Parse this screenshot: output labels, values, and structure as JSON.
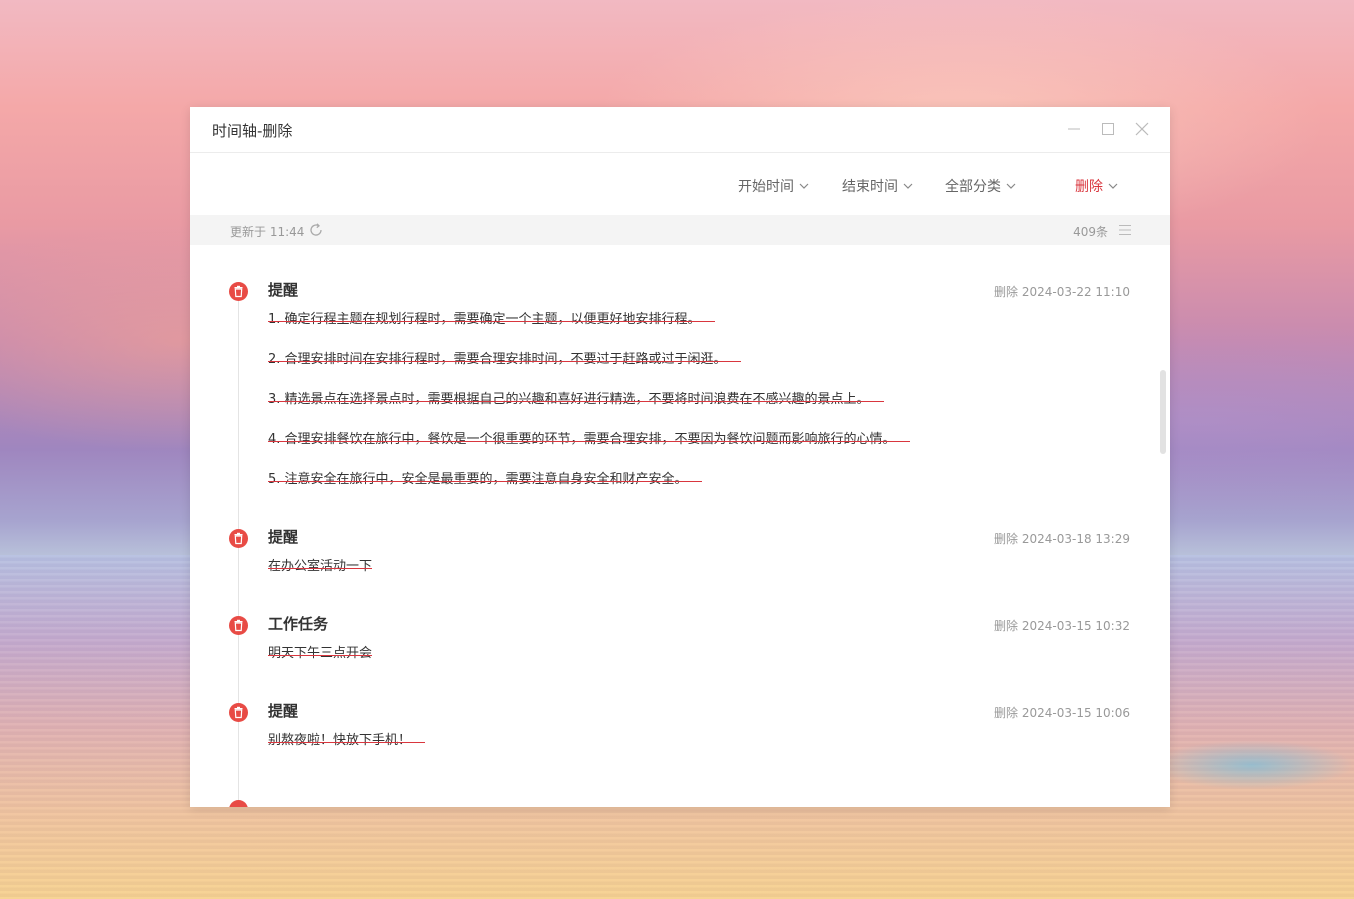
{
  "window": {
    "title": "时间轴-删除"
  },
  "filters": {
    "start_time": "开始时间",
    "end_time": "结束时间",
    "category": "全部分类",
    "status": "删除"
  },
  "status": {
    "updated": "更新于 11:44",
    "count": "409条"
  },
  "colors": {
    "accent": "#d9363e",
    "timeline_icon": "#e84b45"
  },
  "entries": [
    {
      "title": "提醒",
      "meta": "删除 2024-03-22 11:10",
      "lines": [
        "1. 确定行程主题在规划行程时，需要确定一个主题，以便更好地安排行程。",
        "2. 合理安排时间在安排行程时，需要合理安排时间，不要过于赶路或过于闲逛。",
        "3. 精选景点在选择景点时，需要根据自己的兴趣和喜好进行精选，不要将时间浪费在不感兴趣的景点上。",
        "4. 合理安排餐饮在旅行中，餐饮是一个很重要的环节，需要合理安排，不要因为餐饮问题而影响旅行的心情。",
        "5. 注意安全在旅行中，安全是最重要的，需要注意自身安全和财产安全。"
      ]
    },
    {
      "title": "提醒",
      "meta": "删除 2024-03-18 13:29",
      "lines": [
        "在办公室活动一下"
      ]
    },
    {
      "title": "工作任务",
      "meta": "删除 2024-03-15 10:32",
      "lines": [
        "明天下午三点开会"
      ]
    },
    {
      "title": "提醒",
      "meta": "删除 2024-03-15 10:06",
      "lines": [
        "别熬夜啦！快放下手机！"
      ]
    }
  ]
}
